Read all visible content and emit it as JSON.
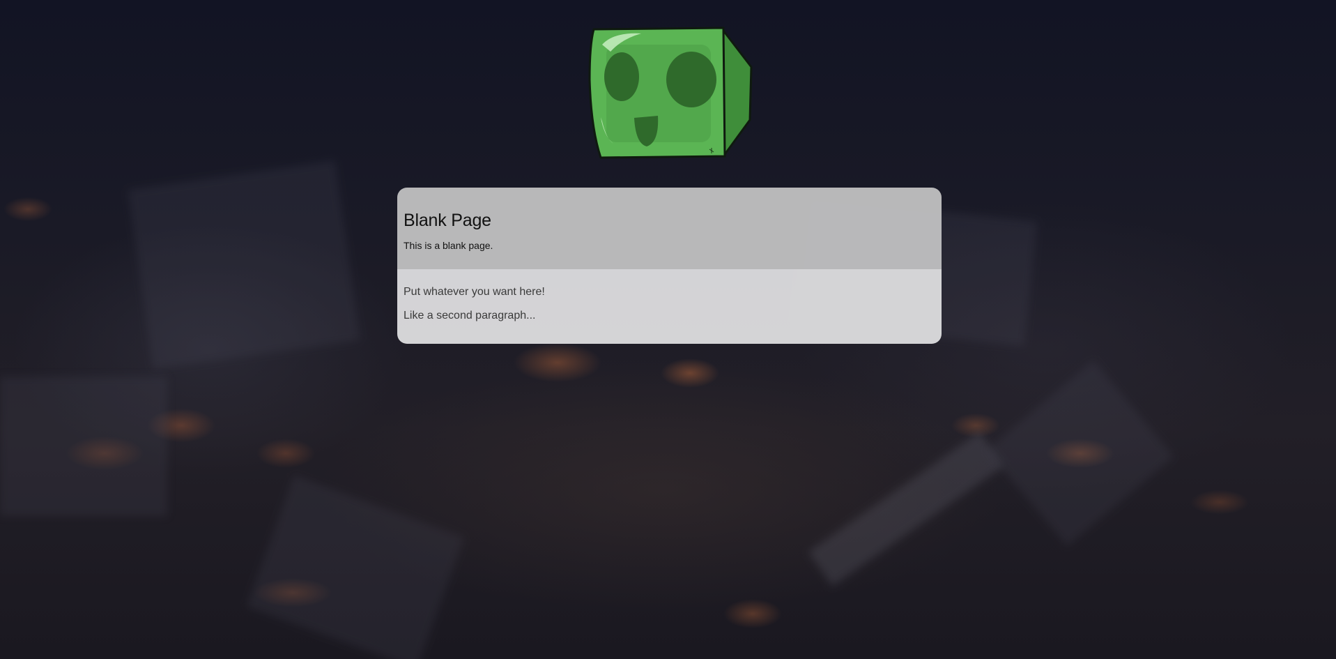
{
  "page": {
    "background_theme": "blurred minecraft night village",
    "accent_color": "#4ea94a"
  },
  "logo": {
    "icon": "slime-icon"
  },
  "card": {
    "title": "Blank Page",
    "subtitle": "This is a blank page.",
    "paragraphs": [
      "Put whatever you want here!",
      "Like a second paragraph..."
    ]
  }
}
